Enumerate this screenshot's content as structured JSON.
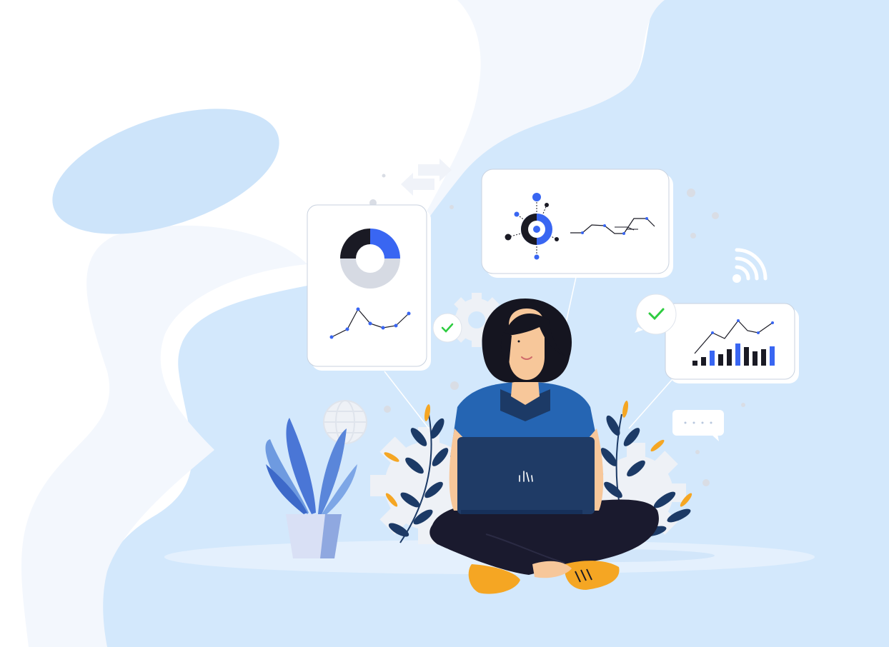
{
  "scene": {
    "description_free": true,
    "colors": {
      "background": "#ffffff",
      "light_blue": "#d3e8fc",
      "mid_blue": "#c2ddf8",
      "accent_blue": "#3966f2",
      "navy": "#1c3a66",
      "dark": "#1a1a24",
      "orange": "#f5a623",
      "green_check": "#2ecc40",
      "card_white": "#ffffff",
      "gray": "#d6dae3"
    },
    "icons": [
      "donut-chart-icon",
      "line-chart-icon",
      "network-diagram-icon",
      "bar-chart-icon",
      "checkmark-icon",
      "wifi-icon",
      "globe-icon",
      "gear-icon",
      "arrows-icon",
      "chat-bubble-icon",
      "laptop-logo-icon",
      "plant-pot-icon"
    ]
  }
}
